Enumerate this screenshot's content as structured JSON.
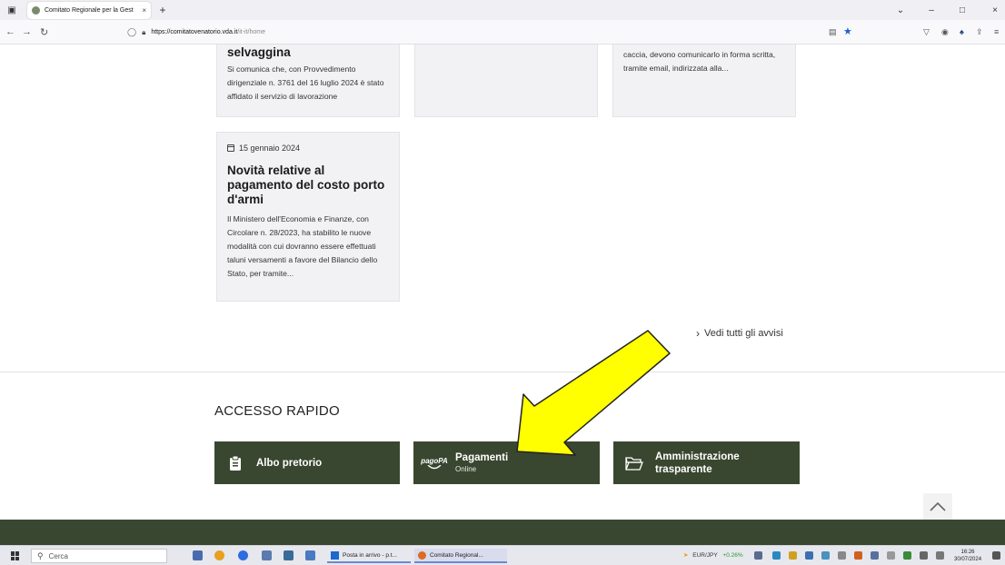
{
  "browser": {
    "tab_title": "Comitato Regionale per la Gest",
    "tab_close": "×",
    "new_tab": "+",
    "url_domain": "https://comitatovenatorio.vda.it",
    "url_path": "/it-it/home",
    "window_controls": [
      "–",
      "□",
      "×"
    ]
  },
  "news": {
    "card1": {
      "title": "selvaggina",
      "text": "Si comunica che, con Provvedimento dirigenziale n. 3761 del 16 luglio 2024 è stato affidato il servizio di lavorazione"
    },
    "card3": {
      "text": "caccia, devono comunicarlo in forma scritta, tramite email, indirizzata alla..."
    },
    "card4": {
      "date": "15 gennaio 2024",
      "title": "Novità relative al pagamento del costo porto d'armi",
      "text": "Il Ministero dell'Economia e Finanze, con Circolare n. 28/2023, ha stabilito le nuove modalità con cui dovranno essere effettuati taluni versamenti a favore del Bilancio dello Stato, per tramite..."
    },
    "see_all": "Vedi tutti gli avvisi"
  },
  "quick_access": {
    "title": "ACCESSO RAPIDO",
    "buttons": [
      {
        "label": "Albo pretorio",
        "sub": "",
        "icon": "clipboard-icon"
      },
      {
        "label": "Pagamenti",
        "sub": "Online",
        "icon": "pagopa-logo-icon",
        "logo_text": "pagoPA"
      },
      {
        "label": "Amministrazione trasparente",
        "sub": "",
        "icon": "folder-open-icon"
      }
    ]
  },
  "taskbar": {
    "search_placeholder": "Cerca",
    "apps": [
      "Posta in arrivo - p.t...",
      "Comitato Regional..."
    ],
    "ticker_pair": "EUR/JPY",
    "ticker_change": "+0.26%",
    "time": "16:26",
    "date": "30/07/2024"
  },
  "colors": {
    "accent_green": "#3a4730",
    "arrow_yellow": "#ffff00"
  }
}
